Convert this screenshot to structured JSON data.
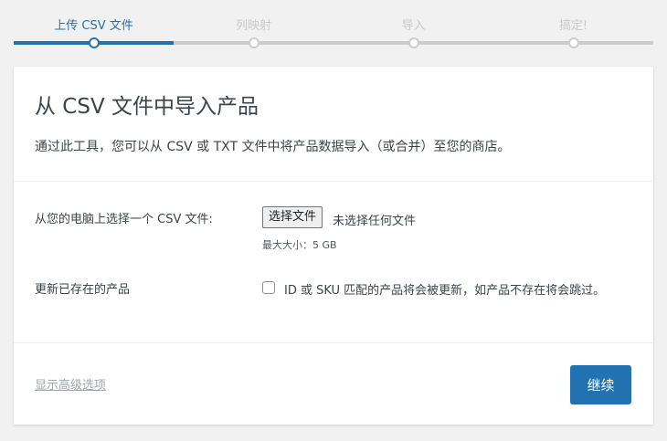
{
  "steps": [
    {
      "label": "上传 CSV 文件",
      "active": true
    },
    {
      "label": "列映射",
      "active": false
    },
    {
      "label": "导入",
      "active": false
    },
    {
      "label": "搞定!",
      "active": false
    }
  ],
  "header": {
    "title": "从 CSV 文件中导入产品",
    "description": "通过此工具，您可以从 CSV 或 TXT 文件中将产品数据导入（或合并）至您的商店。"
  },
  "form": {
    "file_label": "从您的电脑上选择一个 CSV 文件:",
    "file_button": "选择文件",
    "file_status": "未选择任何文件",
    "max_size": "最大大小：5 GB",
    "update_label": "更新已存在的产品",
    "update_checkbox_label": "ID 或 SKU 匹配的产品将会被更新，如产品不存在将会跳过。",
    "update_checked": false
  },
  "footer": {
    "advanced_link": "显示高级选项",
    "continue_button": "继续"
  },
  "colors": {
    "accent": "#2271b1",
    "inactive_step": "#cccccc",
    "background": "#f1f1f1"
  }
}
